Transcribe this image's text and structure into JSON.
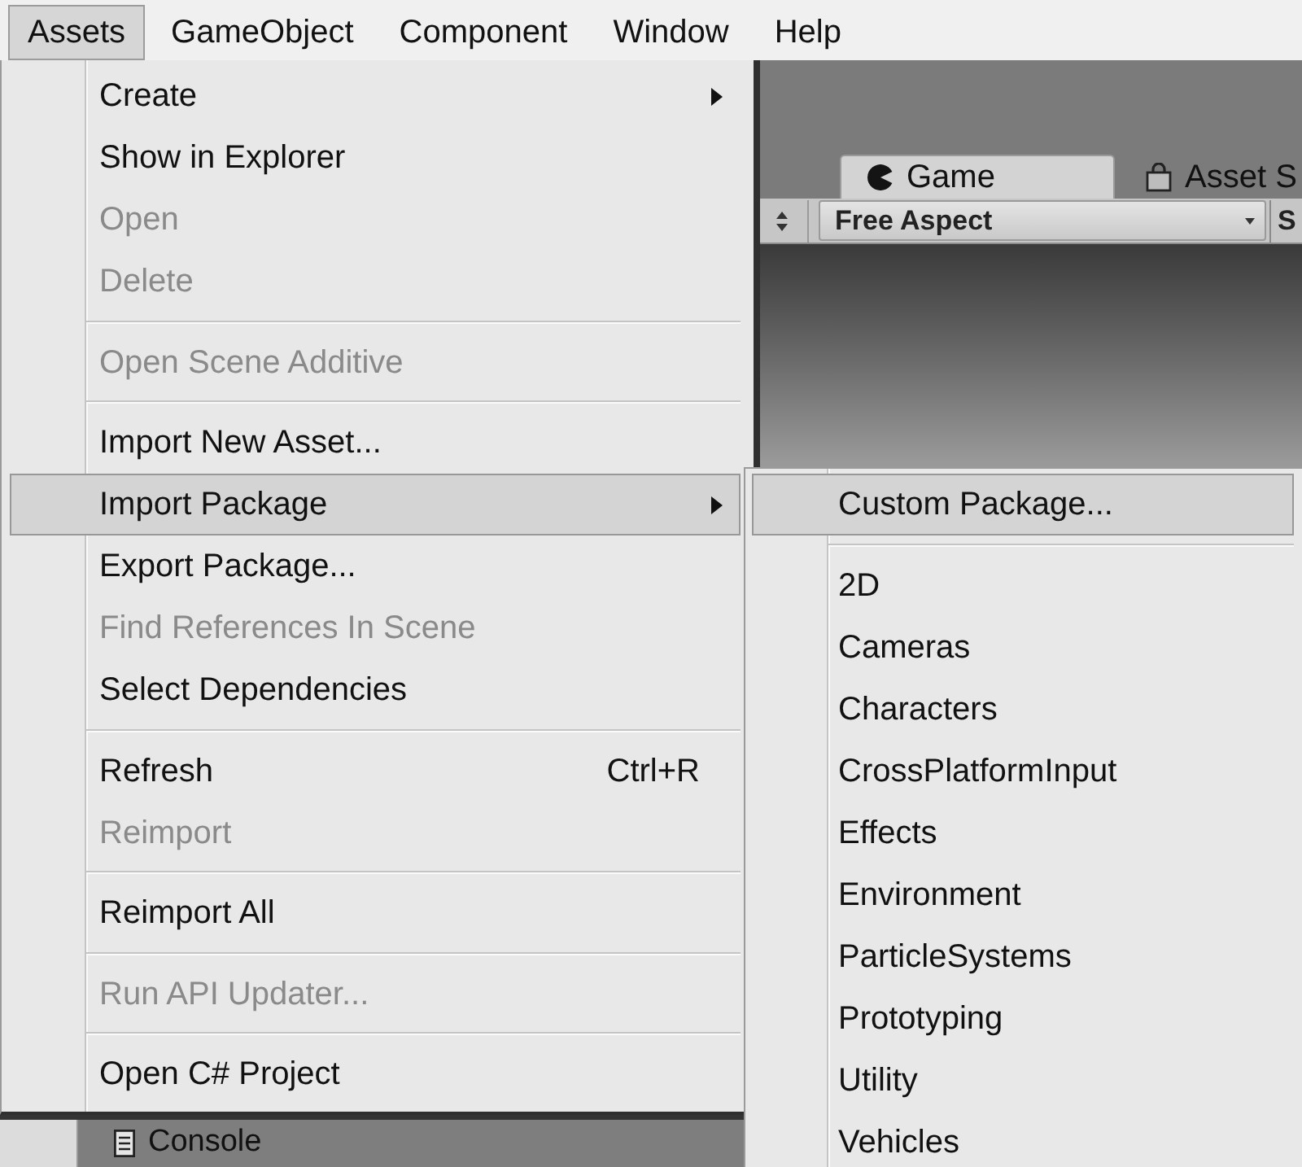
{
  "menu_bar": {
    "items": [
      {
        "label": "Assets",
        "selected": true
      },
      {
        "label": "GameObject",
        "selected": false
      },
      {
        "label": "Component",
        "selected": false
      },
      {
        "label": "Window",
        "selected": false
      },
      {
        "label": "Help",
        "selected": false
      }
    ]
  },
  "game_panel": {
    "tabs": [
      {
        "kind": "game",
        "label": "Game",
        "selected": true
      },
      {
        "kind": "store",
        "label": "Asset S",
        "selected": false
      }
    ],
    "toolbar": {
      "aspect": "Free Aspect",
      "button_3": "S"
    }
  },
  "bottom_panel": {
    "tabs": [
      {
        "kind": "blank",
        "selected": true
      },
      {
        "kind": "console",
        "label": "Console",
        "selected": false
      }
    ]
  },
  "assets_menu": {
    "items": [
      {
        "kind": "item",
        "label": "Create",
        "disabled": false,
        "selected": false,
        "submenu": true
      },
      {
        "kind": "item",
        "label": "Show in Explorer",
        "disabled": false,
        "selected": false,
        "submenu": false
      },
      {
        "kind": "item",
        "label": "Open",
        "disabled": true,
        "selected": false,
        "submenu": false
      },
      {
        "kind": "item",
        "label": "Delete",
        "disabled": true,
        "selected": false,
        "submenu": false
      },
      {
        "kind": "separator"
      },
      {
        "kind": "item",
        "label": "Open Scene Additive",
        "disabled": true,
        "selected": false,
        "submenu": false
      },
      {
        "kind": "separator"
      },
      {
        "kind": "item",
        "label": "Import New Asset...",
        "disabled": false,
        "selected": false,
        "submenu": false
      },
      {
        "kind": "item",
        "label": "Import Package",
        "disabled": false,
        "selected": true,
        "submenu": true
      },
      {
        "kind": "item",
        "label": "Export Package...",
        "disabled": false,
        "selected": false,
        "submenu": false
      },
      {
        "kind": "item",
        "label": "Find References In Scene",
        "disabled": true,
        "selected": false,
        "submenu": false
      },
      {
        "kind": "item",
        "label": "Select Dependencies",
        "disabled": false,
        "selected": false,
        "submenu": false
      },
      {
        "kind": "separator"
      },
      {
        "kind": "item",
        "label": "Refresh",
        "shortcut": "Ctrl+R",
        "disabled": false,
        "selected": false,
        "submenu": false
      },
      {
        "kind": "item",
        "label": "Reimport",
        "disabled": true,
        "selected": false,
        "submenu": false
      },
      {
        "kind": "separator"
      },
      {
        "kind": "item",
        "label": "Reimport All",
        "disabled": false,
        "selected": false,
        "submenu": false
      },
      {
        "kind": "separator"
      },
      {
        "kind": "item",
        "label": "Run API Updater...",
        "disabled": true,
        "selected": false,
        "submenu": false
      },
      {
        "kind": "separator"
      },
      {
        "kind": "item",
        "label": "Open C# Project",
        "disabled": false,
        "selected": false,
        "submenu": false
      }
    ]
  },
  "import_package_submenu": {
    "items": [
      {
        "kind": "item",
        "label": "Custom Package...",
        "disabled": false,
        "selected": true,
        "submenu": false
      },
      {
        "kind": "separator"
      },
      {
        "kind": "item",
        "label": "2D",
        "disabled": false,
        "selected": false,
        "submenu": false
      },
      {
        "kind": "item",
        "label": "Cameras",
        "disabled": false,
        "selected": false,
        "submenu": false
      },
      {
        "kind": "item",
        "label": "Characters",
        "disabled": false,
        "selected": false,
        "submenu": false
      },
      {
        "kind": "item",
        "label": "CrossPlatformInput",
        "disabled": false,
        "selected": false,
        "submenu": false
      },
      {
        "kind": "item",
        "label": "Effects",
        "disabled": false,
        "selected": false,
        "submenu": false
      },
      {
        "kind": "item",
        "label": "Environment",
        "disabled": false,
        "selected": false,
        "submenu": false
      },
      {
        "kind": "item",
        "label": "ParticleSystems",
        "disabled": false,
        "selected": false,
        "submenu": false
      },
      {
        "kind": "item",
        "label": "Prototyping",
        "disabled": false,
        "selected": false,
        "submenu": false
      },
      {
        "kind": "item",
        "label": "Utility",
        "disabled": false,
        "selected": false,
        "submenu": false
      },
      {
        "kind": "item",
        "label": "Vehicles",
        "disabled": false,
        "selected": false,
        "submenu": false
      }
    ]
  }
}
